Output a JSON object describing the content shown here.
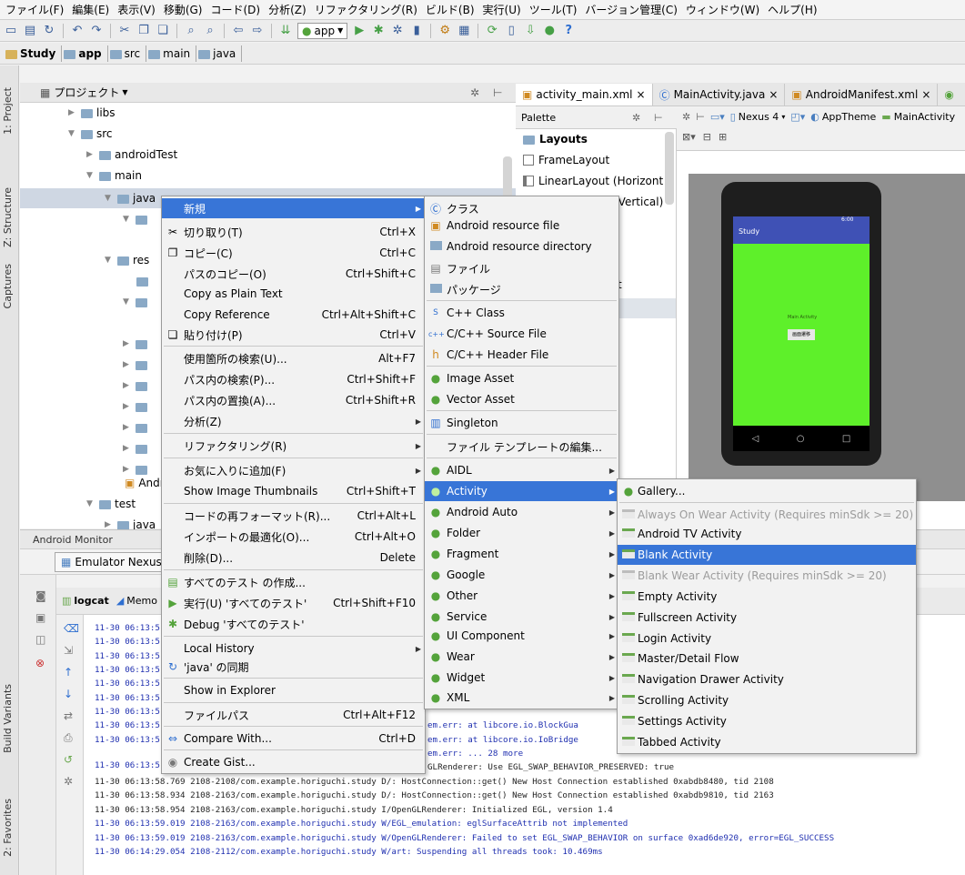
{
  "menubar": [
    "ファイル(F)",
    "編集(E)",
    "表示(V)",
    "移動(G)",
    "コード(D)",
    "分析(Z)",
    "リファクタリング(R)",
    "ビルド(B)",
    "実行(U)",
    "ツール(T)",
    "バージョン管理(C)",
    "ウィンドウ(W)",
    "ヘルプ(H)"
  ],
  "toolbar": {
    "app_combo": "app"
  },
  "breadcrumb": [
    "Study",
    "app",
    "src",
    "main",
    "java"
  ],
  "left_tabs": {
    "project": "1: Project",
    "structure": "Z: Structure",
    "captures": "Captures",
    "build_variants": "Build Variants",
    "favorites": "2: Favorites"
  },
  "project_panel": {
    "title": "プロジェクト"
  },
  "tree": {
    "libs": "libs",
    "src": "src",
    "androidTest": "androidTest",
    "main": "main",
    "java": "java",
    "res": "res",
    "andr": "Andr",
    "test": "test",
    "java2": "java"
  },
  "editor_tabs": [
    "activity_main.xml",
    "MainActivity.java",
    "AndroidManifest.xml"
  ],
  "palette": {
    "title": "Palette",
    "group": "Layouts",
    "items": [
      "FrameLayout",
      "LinearLayout (Horizont",
      "(Vertical)",
      "t"
    ]
  },
  "design_toolbar": {
    "device": "Nexus 4",
    "theme": "AppTheme",
    "activity": "MainActivity"
  },
  "preview": {
    "app_title": "Study",
    "status": "6:00",
    "body_text": "Main Activity",
    "button": "画面遷移"
  },
  "monitor": {
    "title": "Android Monitor",
    "device": "Emulator Nexus"
  },
  "log_tabs": {
    "logcat": "logcat",
    "memory": "Memo"
  },
  "log_lines": [
    "11-30 06:13:5",
    "11-30 06:13:5",
    "11-30 06:13:5",
    "11-30 06:13:5",
    "11-30 06:13:5",
    "11-30 06:13:5",
    "11-30 06:13:5",
    "11-30 06:13:5",
    "11-30 06:13:5",
    "11-30 06:13:5"
  ],
  "log_fragments": {
    "f1": "em.err:     at libcore.io.BlockGua",
    "f2": "em.err:     at libcore.io.IoBridge",
    "f3": "em.err:  ... 28 more",
    "f4": "GLRenderer: Use EGL_SWAP_BEHAVIOR_PRESERVED: true"
  },
  "log_full": [
    "11-30 06:13:58.769 2108-2108/com.example.horiguchi.study D/: HostConnection::get() New Host Connection established 0xabdb8480, tid 2108",
    "11-30 06:13:58.934 2108-2163/com.example.horiguchi.study D/: HostConnection::get() New Host Connection established 0xabdb9810, tid 2163",
    "11-30 06:13:58.954 2108-2163/com.example.horiguchi.study I/OpenGLRenderer: Initialized EGL, version 1.4",
    "11-30 06:13:59.019 2108-2163/com.example.horiguchi.study W/EGL_emulation: eglSurfaceAttrib not implemented",
    "11-30 06:13:59.019 2108-2163/com.example.horiguchi.study W/OpenGLRenderer: Failed to set EGL_SWAP_BEHAVIOR on surface 0xad6de920, error=EGL_SUCCESS",
    "11-30 06:14:29.054 2108-2112/com.example.horiguchi.study W/art: Suspending all threads took: 10.469ms"
  ],
  "context_menu": [
    {
      "label": "新規",
      "shortcut": "",
      "submenu": true
    },
    {
      "label": "切り取り(T)",
      "shortcut": "Ctrl+X"
    },
    {
      "label": "コピー(C)",
      "shortcut": "Ctrl+C"
    },
    {
      "label": "パスのコピー(O)",
      "shortcut": "Ctrl+Shift+C"
    },
    {
      "label": "Copy as Plain Text",
      "shortcut": ""
    },
    {
      "label": "Copy Reference",
      "shortcut": "Ctrl+Alt+Shift+C"
    },
    {
      "label": "貼り付け(P)",
      "shortcut": "Ctrl+V"
    },
    {
      "label": "使用箇所の検索(U)...",
      "shortcut": "Alt+F7"
    },
    {
      "label": "パス内の検索(P)...",
      "shortcut": "Ctrl+Shift+F"
    },
    {
      "label": "パス内の置換(A)...",
      "shortcut": "Ctrl+Shift+R"
    },
    {
      "label": "分析(Z)",
      "shortcut": "",
      "submenu": true
    },
    {
      "label": "リファクタリング(R)",
      "shortcut": "",
      "submenu": true
    },
    {
      "label": "お気に入りに追加(F)",
      "shortcut": "",
      "submenu": true
    },
    {
      "label": "Show Image Thumbnails",
      "shortcut": "Ctrl+Shift+T"
    },
    {
      "label": "コードの再フォーマット(R)...",
      "shortcut": "Ctrl+Alt+L"
    },
    {
      "label": "インポートの最適化(O)...",
      "shortcut": "Ctrl+Alt+O"
    },
    {
      "label": "削除(D)...",
      "shortcut": "Delete"
    },
    {
      "label": "すべてのテスト の作成...",
      "shortcut": ""
    },
    {
      "label": "実行(U) 'すべてのテスト'",
      "shortcut": "Ctrl+Shift+F10"
    },
    {
      "label": "Debug 'すべてのテスト'",
      "shortcut": ""
    },
    {
      "label": "Local History",
      "shortcut": "",
      "submenu": true
    },
    {
      "label": "'java' の同期",
      "shortcut": ""
    },
    {
      "label": "Show in Explorer",
      "shortcut": ""
    },
    {
      "label": "ファイルパス",
      "shortcut": "Ctrl+Alt+F12"
    },
    {
      "label": "Compare With...",
      "shortcut": "Ctrl+D"
    },
    {
      "label": "Create Gist...",
      "shortcut": ""
    }
  ],
  "new_submenu": [
    {
      "label": "クラス"
    },
    {
      "label": "Android resource file"
    },
    {
      "label": "Android resource directory"
    },
    {
      "label": "ファイル"
    },
    {
      "label": "パッケージ"
    },
    {
      "label": "C++ Class"
    },
    {
      "label": "C/C++ Source File"
    },
    {
      "label": "C/C++ Header File"
    },
    {
      "label": "Image Asset"
    },
    {
      "label": "Vector Asset"
    },
    {
      "label": "Singleton"
    },
    {
      "label": "ファイル テンプレートの編集..."
    },
    {
      "label": "AIDL",
      "submenu": true
    },
    {
      "label": "Activity",
      "submenu": true
    },
    {
      "label": "Android Auto",
      "submenu": true
    },
    {
      "label": "Folder",
      "submenu": true
    },
    {
      "label": "Fragment",
      "submenu": true
    },
    {
      "label": "Google",
      "submenu": true
    },
    {
      "label": "Other",
      "submenu": true
    },
    {
      "label": "Service",
      "submenu": true
    },
    {
      "label": "UI Component",
      "submenu": true
    },
    {
      "label": "Wear",
      "submenu": true
    },
    {
      "label": "Widget",
      "submenu": true
    },
    {
      "label": "XML",
      "submenu": true
    }
  ],
  "activity_submenu": [
    {
      "label": "Gallery..."
    },
    {
      "label": "Always On Wear Activity (Requires minSdk >= 20)"
    },
    {
      "label": "Android TV Activity"
    },
    {
      "label": "Blank Activity"
    },
    {
      "label": "Blank Wear Activity (Requires minSdk >= 20)"
    },
    {
      "label": "Empty Activity"
    },
    {
      "label": "Fullscreen Activity"
    },
    {
      "label": "Login Activity"
    },
    {
      "label": "Master/Detail Flow"
    },
    {
      "label": "Navigation Drawer Activity"
    },
    {
      "label": "Scrolling Activity"
    },
    {
      "label": "Settings Activity"
    },
    {
      "label": "Tabbed Activity"
    }
  ]
}
